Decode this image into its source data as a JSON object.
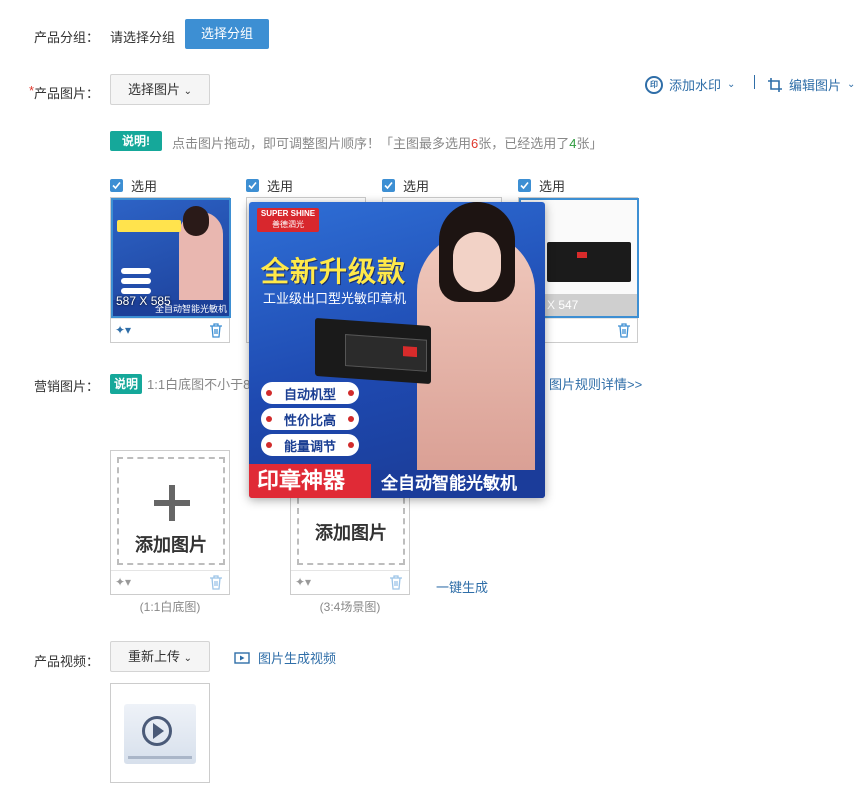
{
  "group": {
    "label": "产品分组：",
    "value": "请选择分组",
    "button": "选择分组"
  },
  "images": {
    "required_mark": "*",
    "label": "产品图片：",
    "select_button": "选择图片",
    "watermark": "添加水印",
    "edit": "编辑图片",
    "note_badge": "说明!",
    "note_text_1": "点击图片拖动，即可调整图片顺序！「主图最多选用",
    "max_count": "6",
    "note_text_2": "张，已经选用了",
    "used_count": "4",
    "note_text_3": "张」",
    "items": [
      {
        "check_label": "选用",
        "size": "587 X 585",
        "caption": "全自动智能光敏机"
      },
      {
        "check_label": "选用"
      },
      {
        "check_label": "选用"
      },
      {
        "check_label": "选用",
        "size": "X 547"
      }
    ]
  },
  "preview": {
    "brand": "SUPER SHINE",
    "brand_sub": "善德泗光",
    "headline": "全新升级款",
    "subhead": "工业级出口型光敏印章机",
    "features": [
      "自动机型",
      "性价比高",
      "能量调节"
    ],
    "banner_left": "印章神器",
    "banner_right": "全自动智能光敏机"
  },
  "marketing": {
    "label": "营销图片：",
    "note_badge": "说明",
    "note_text": "1:1白底图不小于8",
    "rules_link": "图片规则详情>>",
    "add_label_1": "添加图片",
    "add_label_2": "添加图片",
    "caption_1": "(1:1白底图)",
    "caption_2": "(3:4场景图)",
    "generate": "一键生成"
  },
  "video": {
    "label": "产品视频：",
    "reupload": "重新上传",
    "generate": "图片生成视频"
  }
}
